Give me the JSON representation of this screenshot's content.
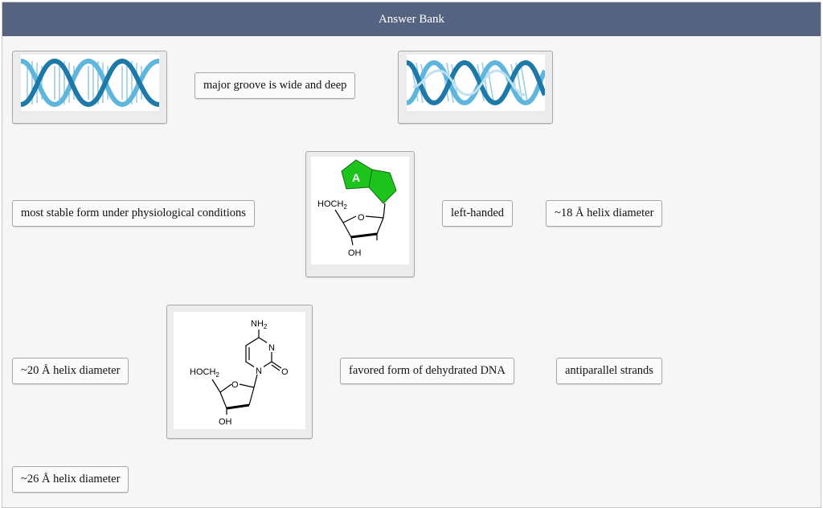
{
  "header": {
    "title": "Answer Bank"
  },
  "items": {
    "major_groove": "major groove is wide and deep",
    "most_stable": "most stable form under physiological conditions",
    "left_handed": "left-handed",
    "helix_18": "~18 Å helix diameter",
    "helix_20": "~20 Å helix diameter",
    "dehydrated": "favored form of dehydrated DNA",
    "antiparallel": "antiparallel strands",
    "helix_26": "~26 Å helix diameter"
  },
  "structures": {
    "purine": {
      "base_letter": "A",
      "sugar_group": "HOCH",
      "sugar_sub": "2",
      "ring_o": "O",
      "hydroxyl": "OH"
    },
    "pyrimidine": {
      "amine": "NH",
      "amine_sub": "2",
      "ring_n1": "N",
      "ring_n3": "N",
      "carbonyl_o": "O",
      "sugar_group": "HOCH",
      "sugar_sub": "2",
      "ring_o": "O",
      "hydroxyl": "OH"
    }
  },
  "colors": {
    "header_bg": "#566380",
    "helix_dark": "#1c79a8",
    "helix_light": "#5fb6dc",
    "base_green": "#1ec41e"
  }
}
